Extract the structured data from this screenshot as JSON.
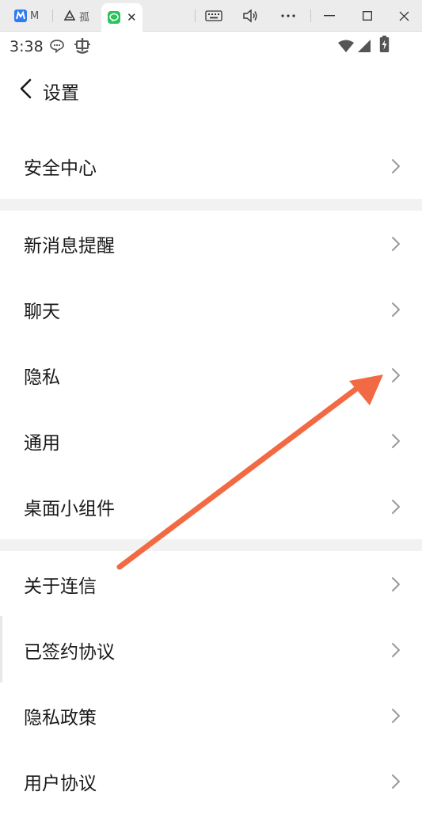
{
  "browser": {
    "tabs": [
      {
        "title": "M",
        "favicon": "blue-m-app-icon",
        "color": "#2d7cf6"
      },
      {
        "title": "孤",
        "favicon": "triangle-app-icon",
        "color": "#333333"
      },
      {
        "title": "",
        "favicon": "green-chat-app-icon",
        "color": "#2bc35a",
        "active": true
      }
    ],
    "tab_close_glyph": "✕",
    "controls": [
      "keyboard-icon",
      "speaker-icon",
      "more-icon",
      "minimize-icon",
      "maximize-icon",
      "close-icon"
    ]
  },
  "status_bar": {
    "time": "3:38",
    "icons": [
      "chat-bubble-icon",
      "bug-icon",
      "wifi-icon",
      "signal-icon",
      "battery-charging-icon"
    ]
  },
  "header": {
    "title": "设置"
  },
  "settings": {
    "group1": [
      {
        "label": "安全中心"
      }
    ],
    "group2": [
      {
        "label": "新消息提醒"
      },
      {
        "label": "聊天"
      },
      {
        "label": "隐私"
      },
      {
        "label": "通用"
      },
      {
        "label": "桌面小组件"
      }
    ],
    "group3": [
      {
        "label": "关于连信"
      },
      {
        "label": "已签约协议"
      },
      {
        "label": "隐私政策"
      },
      {
        "label": "用户协议"
      }
    ]
  },
  "colors": {
    "annotation_arrow": "#f26a43",
    "chevron": "#9a9a9a",
    "section_gap": "#f2f2f2"
  }
}
